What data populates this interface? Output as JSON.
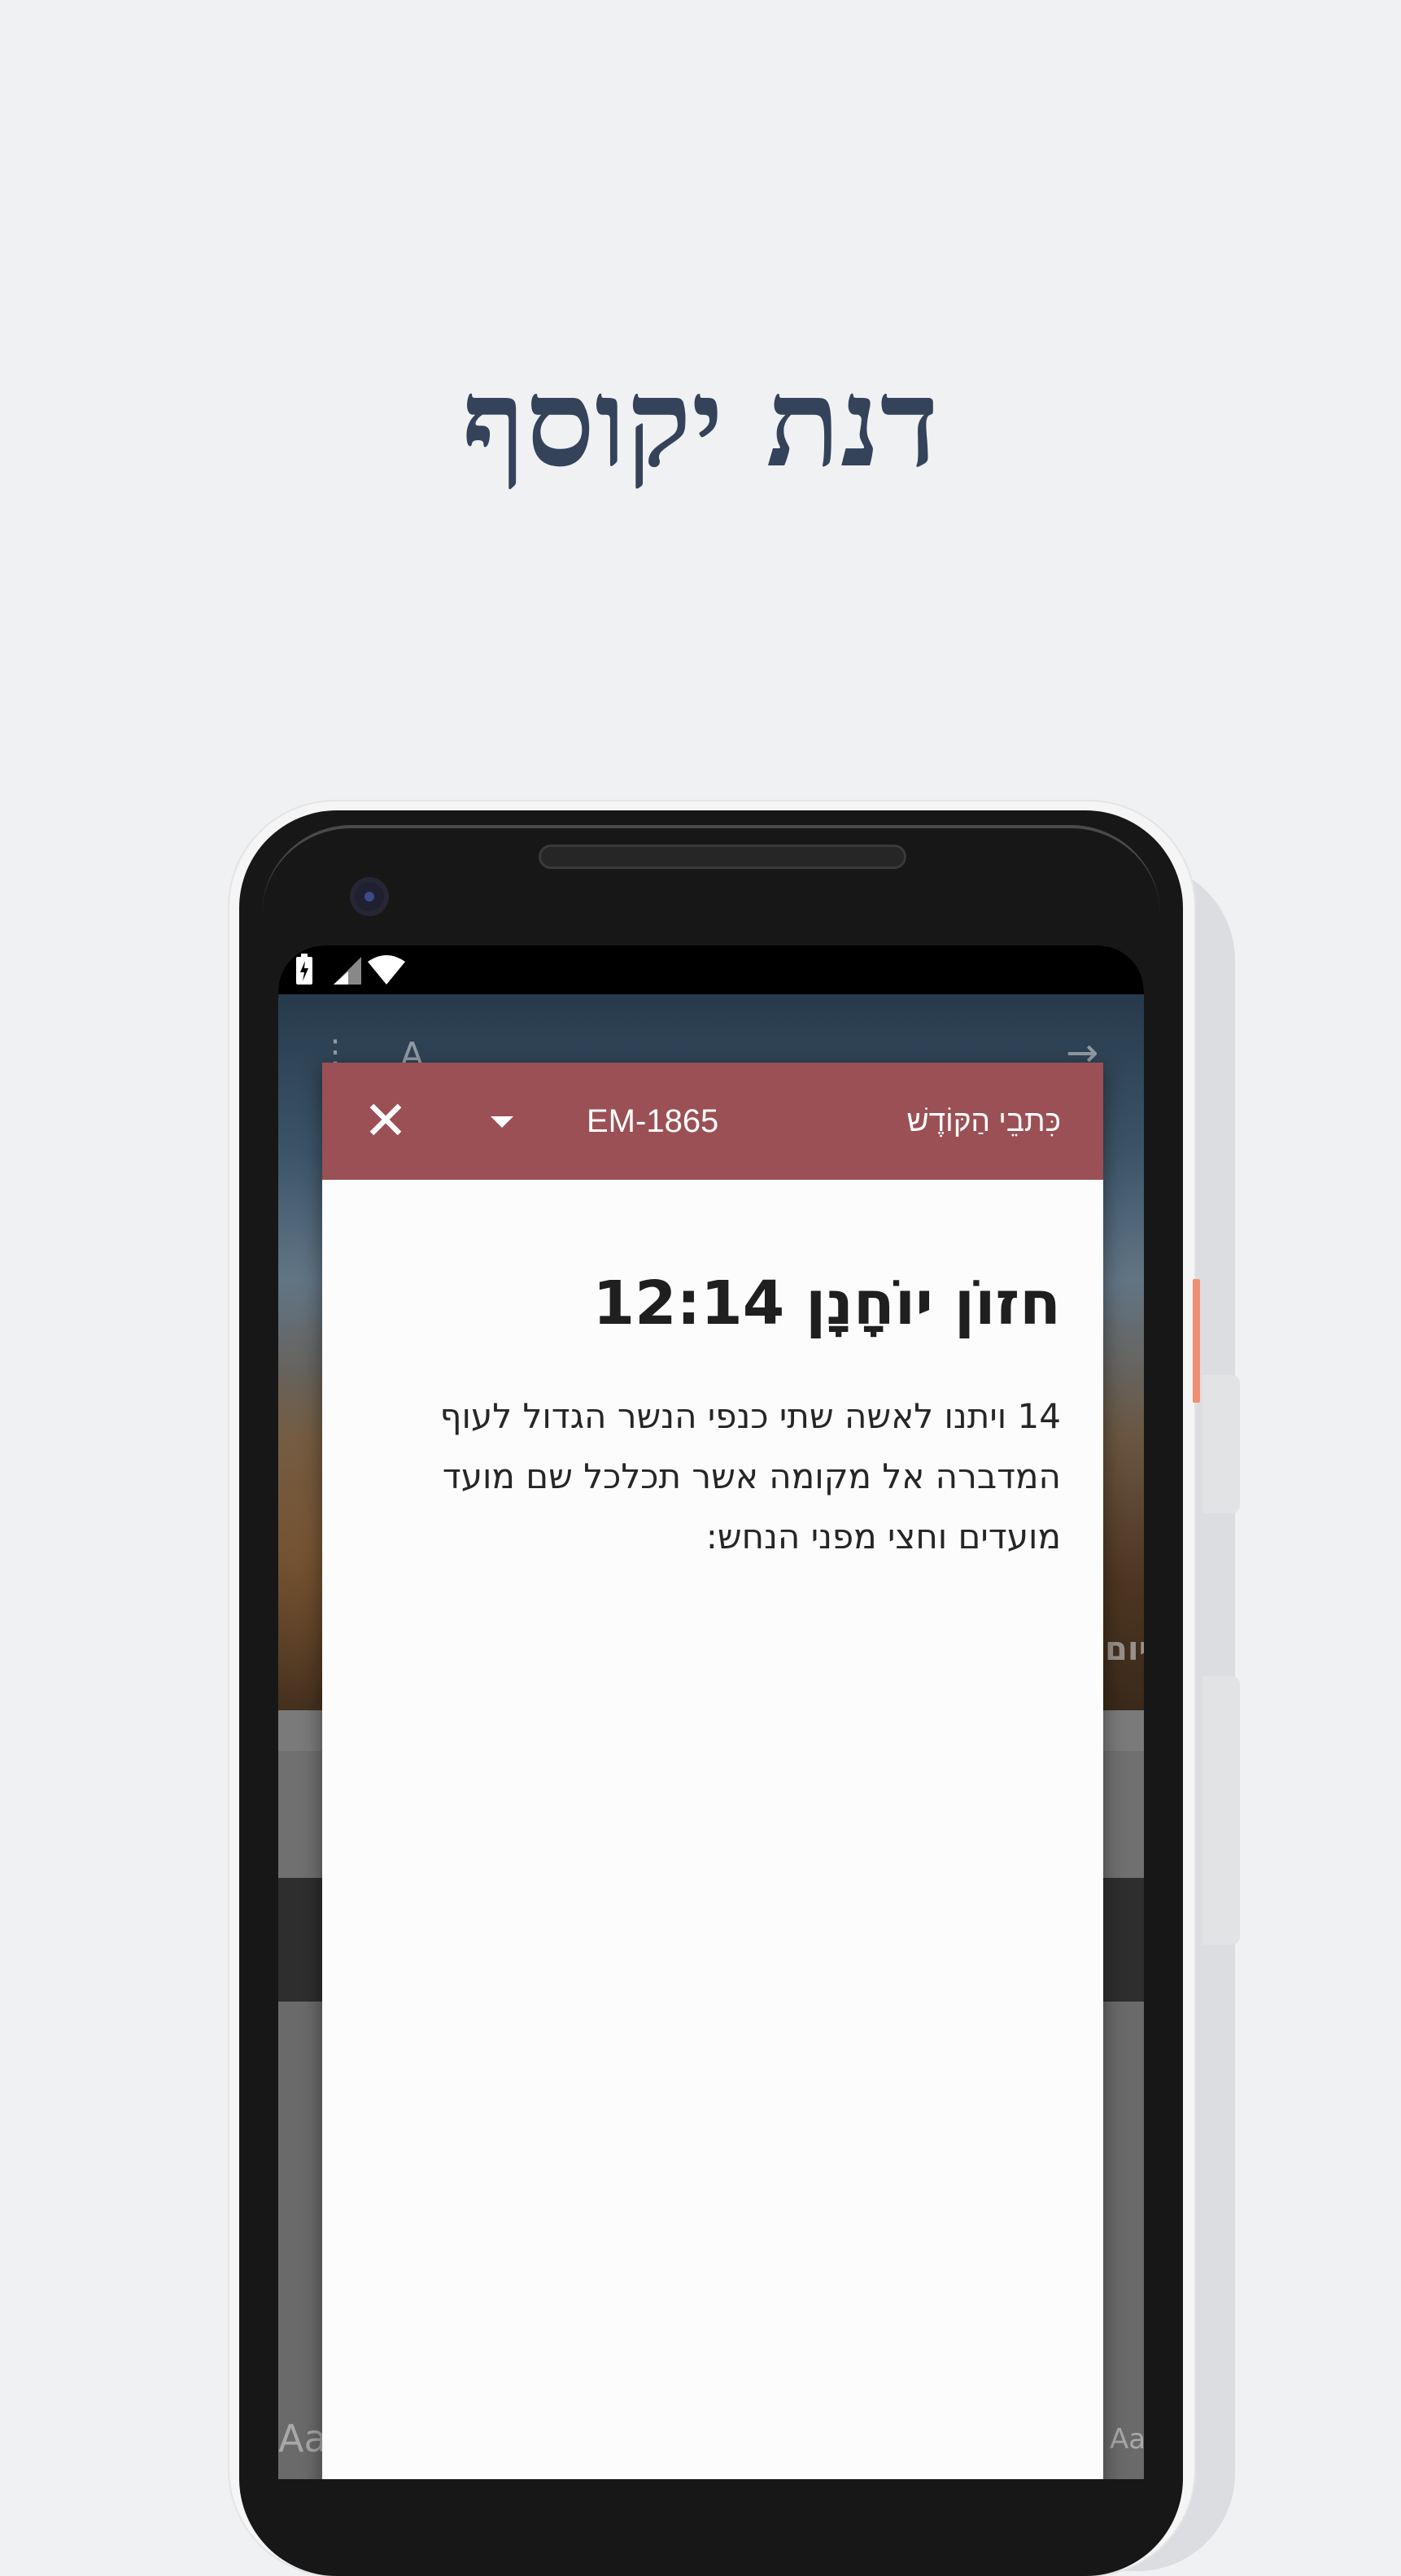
{
  "promo": {
    "title": "דנת יקוסף"
  },
  "status_bar": {
    "battery_icon": "battery-charging-icon",
    "signal_icon": "cell-signal-icon",
    "wifi_icon": "wifi-icon"
  },
  "background_app": {
    "menu_icon": "more-vertical-icon",
    "font_label": "A",
    "forward_icon": "arrow-right-icon",
    "edge_text_right": "יום",
    "bottom_left_label": "Aa",
    "bottom_right_label": "Aa"
  },
  "dialog": {
    "close_icon": "close-icon",
    "dropdown_icon": "dropdown-arrow-icon",
    "version": "EM-1865",
    "source": "כִּתבֵי הַקּוֹדֶשׁ",
    "reference": "חזוֹן יוֹחָנָן 12:14",
    "verse_text": "14 ויתנו לאשה שתי כנפי הנשר הגדול לעוף המדברה אל מקומה אשר תכלכל שם מועד מועדים וחצי מפני הנחש:"
  },
  "colors": {
    "page_background": "#eff1f3",
    "title_color": "#34425a",
    "dialog_bar": "#9b5055",
    "phone_body": "#171717",
    "power_button_accent": "#ef8f73"
  }
}
